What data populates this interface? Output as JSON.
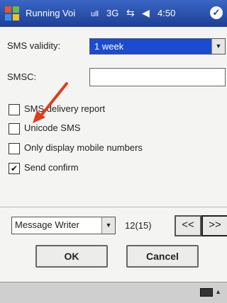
{
  "titlebar": {
    "title": "Running Voi",
    "signal1": "ull",
    "signal2": "3G",
    "connectivity_icon": "connectivity-icon",
    "volume_icon": "speaker-icon",
    "time": "4:50",
    "ok_label": "✓"
  },
  "form": {
    "sms_validity_label": "SMS validity:",
    "sms_validity_value": "1 week",
    "smsc_label": "SMSC:",
    "smsc_value": "",
    "checkboxes": [
      {
        "label": "SMS delivery report",
        "checked": false
      },
      {
        "label": "Unicode SMS",
        "checked": false
      },
      {
        "label": "Only display mobile numbers",
        "checked": false
      },
      {
        "label": "Send confirm",
        "checked": true
      }
    ]
  },
  "footer_controls": {
    "writer_select": "Message Writer",
    "counter": "12(15)",
    "prev": "<<",
    "next": ">>"
  },
  "buttons": {
    "ok": "OK",
    "cancel": "Cancel"
  },
  "colors": {
    "title_bar": "#1d3f97",
    "selection": "#1a4bd0",
    "annotation_arrow": "#e23c1a"
  }
}
